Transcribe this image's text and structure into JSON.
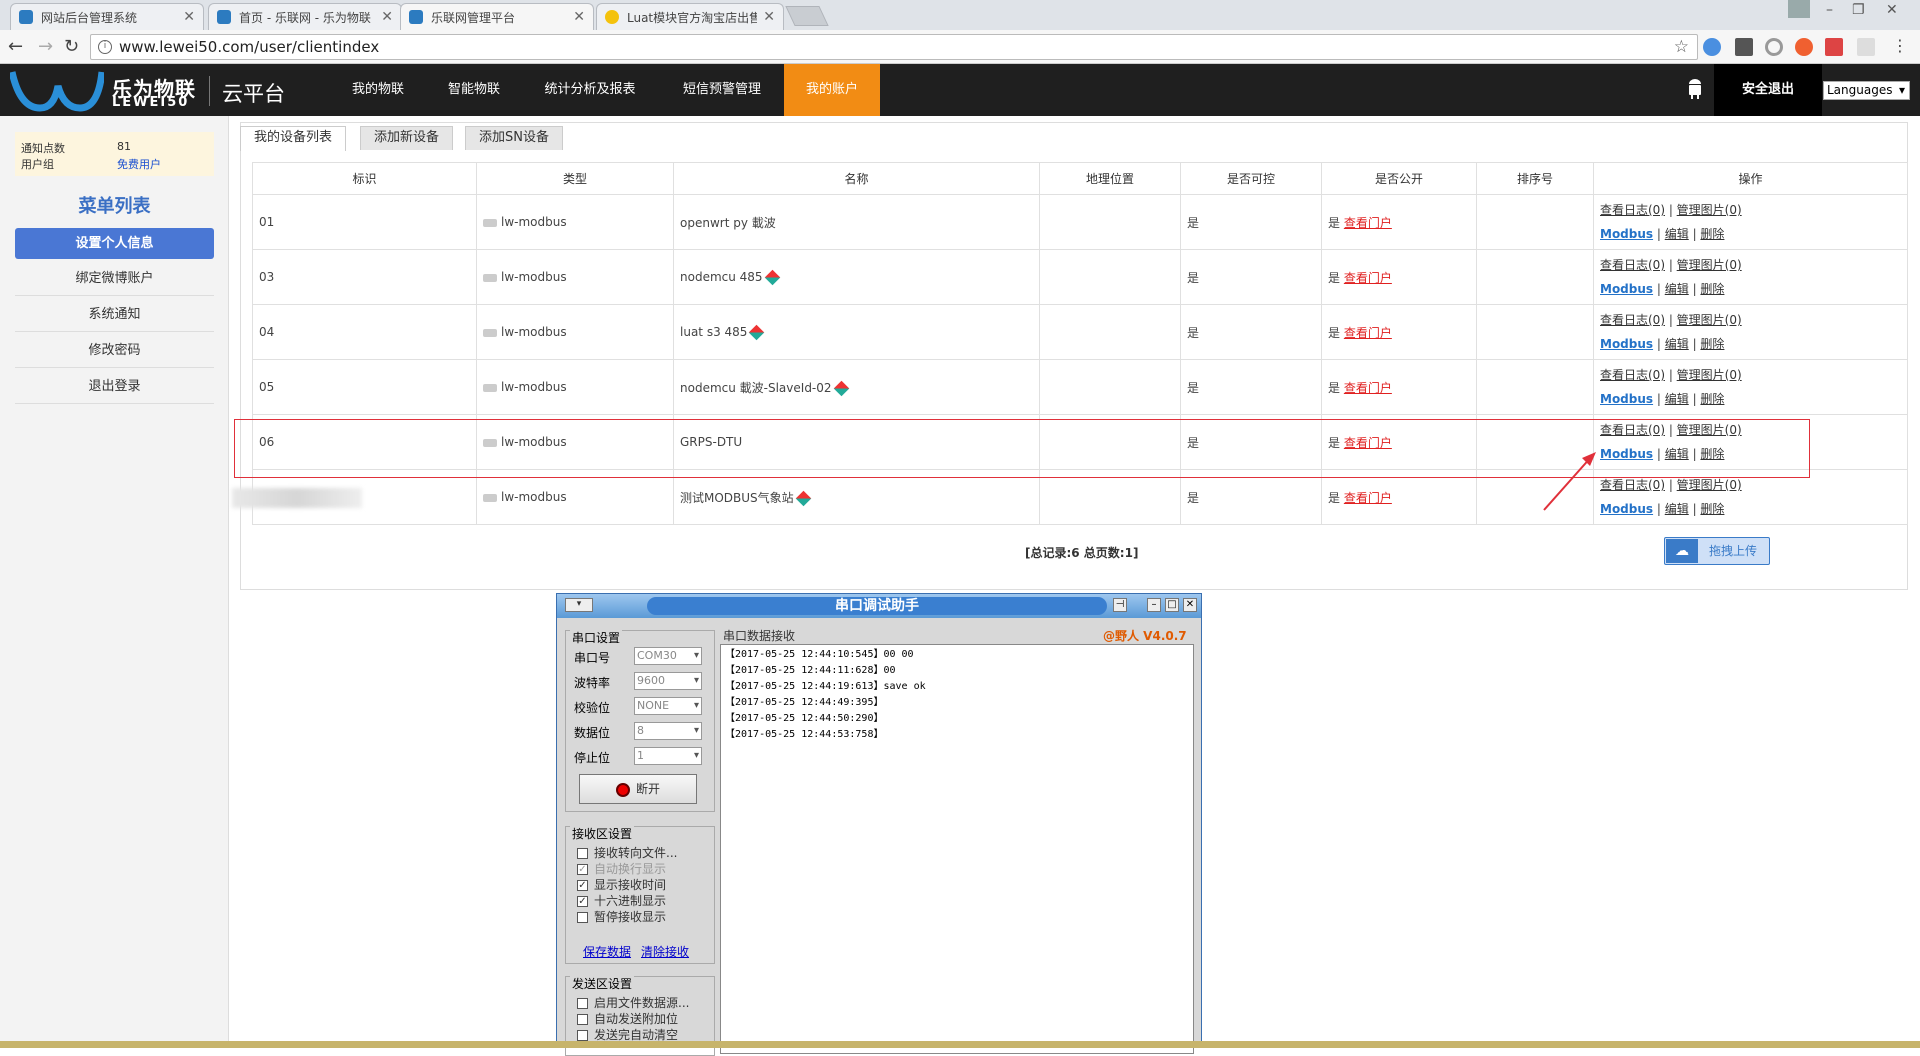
{
  "browser": {
    "tabs": [
      {
        "title": "网站后台管理系统"
      },
      {
        "title": "首页 - 乐联网 - 乐为物联"
      },
      {
        "title": "乐联网管理平台"
      },
      {
        "title": "Luat模块官方淘宝店出售"
      }
    ],
    "url": "www.lewei50.com/user/clientindex"
  },
  "header": {
    "logo_cn": "乐为物联",
    "logo_en": "LEWEI50",
    "platform": "云平台",
    "nav": [
      "我的物联",
      "智能物联",
      "统计分析及报表",
      "短信预警管理",
      "我的账户"
    ],
    "active_nav": "我的账户",
    "logout": "安全退出",
    "languages": "Languages"
  },
  "sidebar": {
    "info": [
      {
        "label": "通知点数",
        "value": "81"
      },
      {
        "label": "用户组",
        "value": "免费用户"
      }
    ],
    "menu_title": "菜单列表",
    "items": [
      "设置个人信息",
      "绑定微博账户",
      "系统通知",
      "修改密码",
      "退出登录"
    ]
  },
  "main": {
    "tabs": [
      "我的设备列表",
      "添加新设备",
      "添加SN设备"
    ],
    "columns": [
      "标识",
      "类型",
      "名称",
      "地理位置",
      "是否可控",
      "是否公开",
      "排序号",
      "操作"
    ],
    "rows": [
      {
        "id": "01",
        "type": "lw-modbus",
        "name": "openwrt py 載波",
        "gem": false,
        "controllable": "是",
        "public": "是",
        "public_link": "查看门户"
      },
      {
        "id": "03",
        "type": "lw-modbus",
        "name": "nodemcu 485",
        "gem": true,
        "controllable": "是",
        "public": "是",
        "public_link": "查看门户"
      },
      {
        "id": "04",
        "type": "lw-modbus",
        "name": "luat s3 485",
        "gem": true,
        "controllable": "是",
        "public": "是",
        "public_link": "查看门户"
      },
      {
        "id": "05",
        "type": "lw-modbus",
        "name": "nodemcu 載波-SlaveId-02",
        "gem": true,
        "controllable": "是",
        "public": "是",
        "public_link": "查看门户"
      },
      {
        "id": "06",
        "type": "lw-modbus",
        "name": "GRPS-DTU",
        "gem": false,
        "controllable": "是",
        "public": "是",
        "public_link": "查看门户"
      },
      {
        "id": "",
        "type": "lw-modbus",
        "name": "测试MODBUS气象站",
        "gem": true,
        "controllable": "是",
        "public": "是",
        "public_link": "查看门户"
      }
    ],
    "ops": {
      "log": "查看日志(0)",
      "pic": "管理图片(0)",
      "modbus": "Modbus",
      "edit": "编辑",
      "delete": "删除"
    },
    "total": "[总记录:6 总页数:1]",
    "upload": "拖拽上传"
  },
  "serial_tool": {
    "title": "串口调试助手",
    "version": "@野人 V4.0.7",
    "port_group": "串口设置",
    "fields": [
      {
        "label": "串口号",
        "value": "COM30"
      },
      {
        "label": "波特率",
        "value": "9600"
      },
      {
        "label": "校验位",
        "value": "NONE"
      },
      {
        "label": "数据位",
        "value": "8"
      },
      {
        "label": "停止位",
        "value": "1"
      }
    ],
    "disconnect": "断开",
    "recv_group": "接收区设置",
    "recv_options": [
      {
        "label": "接收转向文件...",
        "checked": false,
        "disabled": false
      },
      {
        "label": "自动换行显示",
        "checked": true,
        "disabled": true
      },
      {
        "label": "显示接收时间",
        "checked": true,
        "disabled": false
      },
      {
        "label": "十六进制显示",
        "checked": true,
        "disabled": false
      },
      {
        "label": "暂停接收显示",
        "checked": false,
        "disabled": false
      }
    ],
    "save_data": "保存数据",
    "clear_recv": "清除接收",
    "send_group": "发送区设置",
    "send_options": [
      {
        "label": "启用文件数据源...",
        "checked": false
      },
      {
        "label": "自动发送附加位",
        "checked": false
      },
      {
        "label": "发送完自动清空",
        "checked": false
      }
    ],
    "recv_label": "串口数据接收",
    "recv_lines": [
      "【2017-05-25 12:44:10:545】00 00",
      "【2017-05-25 12:44:11:628】00",
      "【2017-05-25 12:44:19:613】save ok",
      "【2017-05-25 12:44:49:395】",
      "【2017-05-25 12:44:50:290】",
      "【2017-05-25 12:44:53:758】"
    ]
  }
}
